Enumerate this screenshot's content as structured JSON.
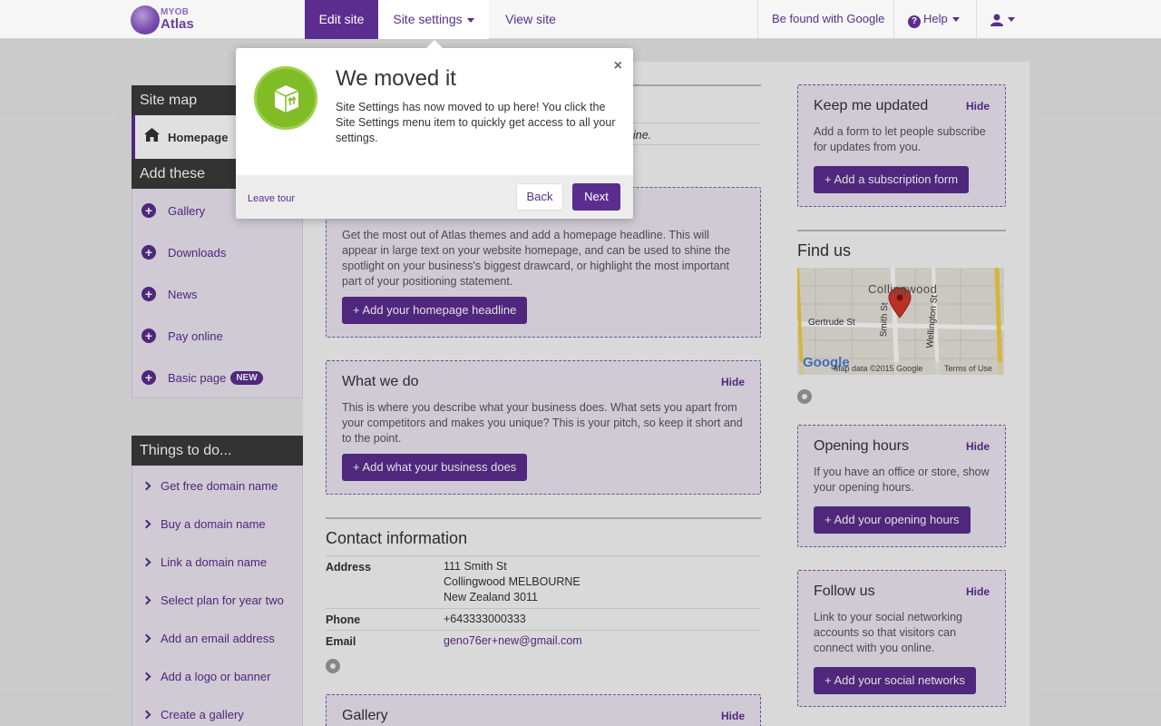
{
  "nav": {
    "logo_line1": "MYOB",
    "logo_line2": "Atlas",
    "tabs": [
      {
        "label": "Edit site"
      },
      {
        "label": "Site settings"
      },
      {
        "label": "View site"
      }
    ],
    "be_found": "Be found with Google",
    "help": "Help"
  },
  "sidebar": {
    "site_map_title": "Site map",
    "homepage_label": "Homepage",
    "add_these_title": "Add these",
    "add_items": [
      {
        "label": "Gallery"
      },
      {
        "label": "Downloads"
      },
      {
        "label": "News"
      },
      {
        "label": "Pay online"
      },
      {
        "label": "Basic page",
        "badge": "NEW"
      }
    ],
    "todo_title": "Things to do...",
    "todo_items": [
      {
        "label": "Get free domain name"
      },
      {
        "label": "Buy a domain name"
      },
      {
        "label": "Link a domain name"
      },
      {
        "label": "Select plan for year two"
      },
      {
        "label": "Add an email address"
      },
      {
        "label": "Add a logo or banner"
      },
      {
        "label": "Create a gallery"
      }
    ]
  },
  "main": {
    "partial_text": "ine.",
    "headline_box": {
      "text": "Get the most out of Atlas themes and add a homepage headline. This will appear in large text on your website homepage, and can be used to shine the spotlight on your business's biggest drawcard, or highlight the most important part of your positioning statement.",
      "button": "+ Add your homepage headline"
    },
    "whatwedo_box": {
      "title": "What we do",
      "hide": "Hide",
      "text": "This is where you describe what your business does. What sets you apart from your competitors and makes you unique? This is your pitch, so keep it short and to the point.",
      "button": "+ Add what your business does"
    },
    "contact": {
      "title": "Contact information",
      "address_label": "Address",
      "address_line1": "111 Smith St",
      "address_line2": "Collingwood MELBOURNE",
      "address_line3": "New Zealand 3011",
      "phone_label": "Phone",
      "phone": "+643333000333",
      "email_label": "Email",
      "email": "geno76er+new@gmail.com"
    },
    "gallery_box": {
      "title": "Gallery",
      "hide": "Hide"
    }
  },
  "right": {
    "keep_updated": {
      "title": "Keep me updated",
      "hide": "Hide",
      "text": "Add a form to let people subscribe for updates from you.",
      "button": "+ Add a subscription form"
    },
    "find_us": {
      "title": "Find us",
      "map_area": "Collingwood",
      "street1": "Gertrude St",
      "street2": "Smith St",
      "street3": "Wellington St",
      "google": "Google",
      "map_data": "Map data ©2015 Google",
      "terms": "Terms of Use"
    },
    "opening_hours": {
      "title": "Opening hours",
      "hide": "Hide",
      "text": "If you have an office or store, show your opening hours.",
      "button": "+ Add your opening hours"
    },
    "follow_us": {
      "title": "Follow us",
      "hide": "Hide",
      "text": "Link to your social networking accounts so that visitors can connect with you online.",
      "button": "+ Add your social networks"
    }
  },
  "tour": {
    "title": "We moved it",
    "body": "Site Settings has now moved to up here! You click the Site Settings menu item to quickly get access to all your settings.",
    "close": "×",
    "leave": "Leave tour",
    "back": "Back",
    "next": "Next"
  }
}
